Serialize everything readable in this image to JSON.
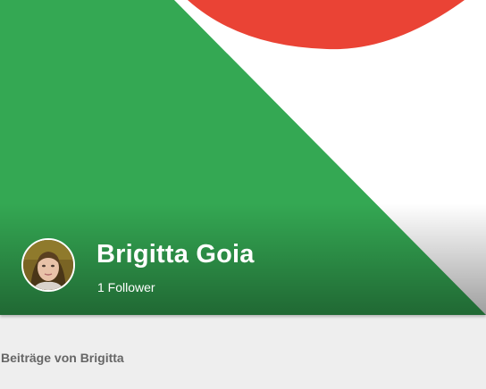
{
  "colors": {
    "cover_green": "#34a853",
    "cover_red": "#ea4335",
    "cover_white": "#ffffff",
    "page_background": "#eeeeee",
    "section_title_text": "#666666"
  },
  "profile": {
    "name": "Brigitta Goia",
    "followers": "1 Follower",
    "avatar_icon": "profile-photo"
  },
  "posts_section": {
    "title": "Beiträge von Brigitta"
  }
}
